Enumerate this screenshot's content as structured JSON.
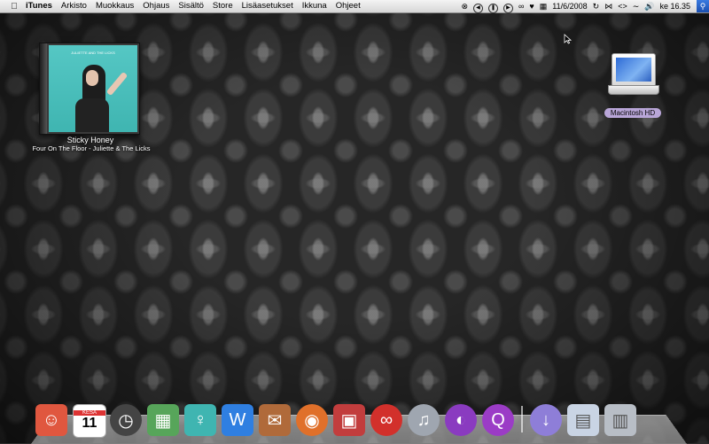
{
  "menubar": {
    "app_name": "iTunes",
    "menus": [
      "Arkisto",
      "Muokkaus",
      "Ohjaus",
      "Sisältö",
      "Store",
      "Lisäasetukset",
      "Ikkuna",
      "Ohjeet"
    ],
    "date": "11/6/2008",
    "clock": "ke 16.35"
  },
  "album": {
    "title": "Sticky Honey",
    "subtitle": "Four On The Floor - Juliette & The Licks",
    "cover_text": "JULIETTE AND THE LICKS"
  },
  "desktop": {
    "disk_label": "Macintosh HD"
  },
  "dock": {
    "items": [
      {
        "name": "finder-icon",
        "color": "#e0573f"
      },
      {
        "name": "calendar-icon",
        "color": "#ffffff",
        "text": "11",
        "month": "KESÄ"
      },
      {
        "name": "dashboard-icon",
        "color": "#444444"
      },
      {
        "name": "stacks-icon",
        "color": "#57a55a"
      },
      {
        "name": "itunes-album-icon",
        "color": "#3fb5b1"
      },
      {
        "name": "word-icon",
        "color": "#2f7fe1"
      },
      {
        "name": "photo-icon",
        "color": "#b06a3a"
      },
      {
        "name": "firefox-icon",
        "color": "#e0702a"
      },
      {
        "name": "iphoto-icon",
        "color": "#c23d3d"
      },
      {
        "name": "lastfm-icon",
        "color": "#d2302b"
      },
      {
        "name": "itunes-icon",
        "color": "#9fa6b0"
      },
      {
        "name": "purple-globe-icon",
        "color": "#8a3bc0"
      },
      {
        "name": "quicktime-icon",
        "color": "#9b3cc6"
      },
      {
        "name": "downloads-icon",
        "color": "#8e7ed8"
      },
      {
        "name": "document-stack-icon",
        "color": "#c9d4e4"
      },
      {
        "name": "trash-icon",
        "color": "#b8bec6"
      }
    ]
  }
}
